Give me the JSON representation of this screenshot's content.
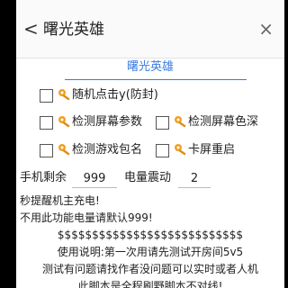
{
  "header": {
    "back_glyph": "<",
    "title": "曙光英雄",
    "close_glyph": "×"
  },
  "tab": {
    "label": "曙光英雄"
  },
  "options": [
    {
      "label": "随机点击y(防封)",
      "checked": false
    },
    {
      "label": "检测屏幕参数",
      "checked": false
    },
    {
      "label": "检测屏幕色深",
      "checked": false
    },
    {
      "label": "检测游戏包名",
      "checked": false
    },
    {
      "label": "卡屏重启",
      "checked": false
    }
  ],
  "fields": {
    "battery_label": "手机剩余",
    "battery_value": "999",
    "vibrate_label": "电量震动",
    "vibrate_value": "2"
  },
  "notes": [
    "秒提醒机主充电!",
    "不用此功能电量请默认999!",
    "$$$$$$$$$$$$$$$$$$$$$$$$$$$",
    "使用说明:第一次用请先测试开房间5v5",
    "测试有问题请找作者没问题可以实时或者人机",
    "此脚本是全程刷野脚本不对线!"
  ],
  "colors": {
    "accent": "#3a7be0",
    "icon": "#f0a020"
  }
}
